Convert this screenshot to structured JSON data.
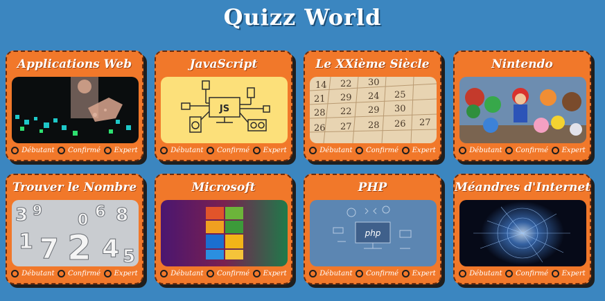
{
  "page": {
    "title": "Quizz World"
  },
  "levels": [
    "Débutant",
    "Confirmé",
    "Expert"
  ],
  "cards": [
    {
      "title": "Applications Web"
    },
    {
      "title": "JavaScript"
    },
    {
      "title": "Le XXième Siècle"
    },
    {
      "title": "Nintendo"
    },
    {
      "title": "Trouver le Nombre"
    },
    {
      "title": "Microsoft"
    },
    {
      "title": "PHP"
    },
    {
      "title": "Méandres d'Internet"
    }
  ],
  "thumbs": {
    "javascript_label": "JS",
    "php_label": "php"
  },
  "colors": {
    "background": "#3b86c0",
    "card": "#f1782a",
    "shadow": "#1f1f1f"
  }
}
